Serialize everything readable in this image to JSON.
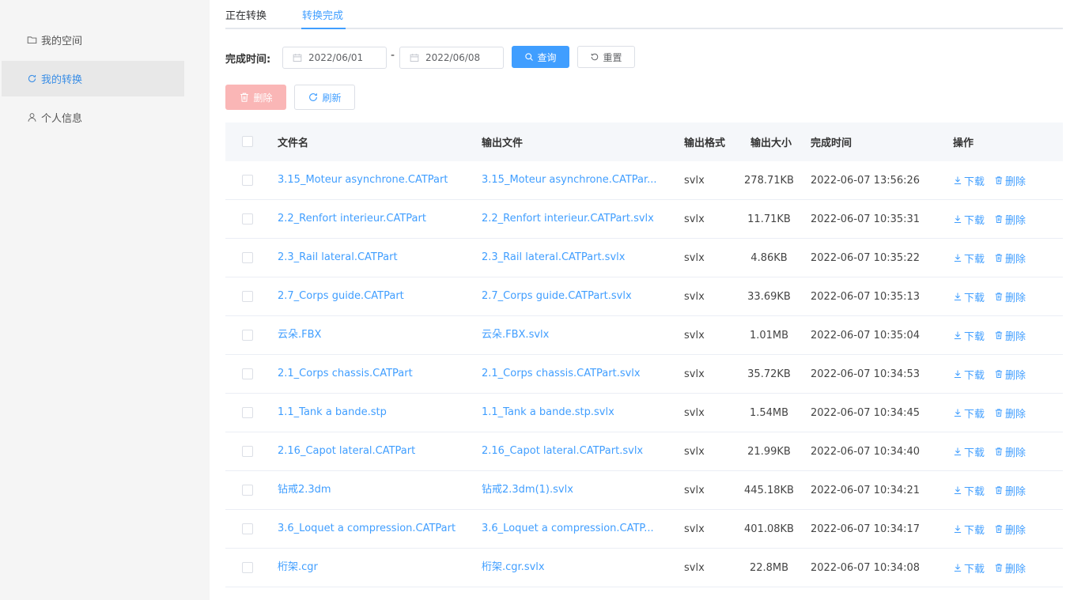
{
  "sidebar": {
    "items": [
      {
        "label": "我的空间",
        "icon": "folder-icon"
      },
      {
        "label": "我的转换",
        "icon": "refresh-icon"
      },
      {
        "label": "个人信息",
        "icon": "user-icon"
      }
    ]
  },
  "tabs": [
    {
      "label": "正在转换"
    },
    {
      "label": "转换完成"
    }
  ],
  "filter": {
    "label": "完成时间:",
    "start_date": "2022/06/01",
    "separator": "-",
    "end_date": "2022/06/08",
    "query_label": "查询",
    "reset_label": "重置"
  },
  "toolbar": {
    "delete_label": "删除",
    "refresh_label": "刷新"
  },
  "table": {
    "headers": {
      "filename": "文件名",
      "output": "输出文件",
      "format": "输出格式",
      "size": "输出大小",
      "time": "完成时间",
      "actions": "操作"
    },
    "download_label": "下载",
    "delete_label": "删除",
    "rows": [
      {
        "filename": "3.15_Moteur asynchrone.CATPart",
        "output": "3.15_Moteur asynchrone.CATPar...",
        "format": "svlx",
        "size": "278.71KB",
        "time": "2022-06-07 13:56:26"
      },
      {
        "filename": "2.2_Renfort interieur.CATPart",
        "output": "2.2_Renfort interieur.CATPart.svlx",
        "format": "svlx",
        "size": "11.71KB",
        "time": "2022-06-07 10:35:31"
      },
      {
        "filename": "2.3_Rail lateral.CATPart",
        "output": "2.3_Rail lateral.CATPart.svlx",
        "format": "svlx",
        "size": "4.86KB",
        "time": "2022-06-07 10:35:22"
      },
      {
        "filename": "2.7_Corps guide.CATPart",
        "output": "2.7_Corps guide.CATPart.svlx",
        "format": "svlx",
        "size": "33.69KB",
        "time": "2022-06-07 10:35:13"
      },
      {
        "filename": "云朵.FBX",
        "output": "云朵.FBX.svlx",
        "format": "svlx",
        "size": "1.01MB",
        "time": "2022-06-07 10:35:04"
      },
      {
        "filename": "2.1_Corps chassis.CATPart",
        "output": "2.1_Corps chassis.CATPart.svlx",
        "format": "svlx",
        "size": "35.72KB",
        "time": "2022-06-07 10:34:53"
      },
      {
        "filename": "1.1_Tank a bande.stp",
        "output": "1.1_Tank a bande.stp.svlx",
        "format": "svlx",
        "size": "1.54MB",
        "time": "2022-06-07 10:34:45"
      },
      {
        "filename": "2.16_Capot lateral.CATPart",
        "output": "2.16_Capot lateral.CATPart.svlx",
        "format": "svlx",
        "size": "21.99KB",
        "time": "2022-06-07 10:34:40"
      },
      {
        "filename": "钻戒2.3dm",
        "output": "钻戒2.3dm(1).svlx",
        "format": "svlx",
        "size": "445.18KB",
        "time": "2022-06-07 10:34:21"
      },
      {
        "filename": "3.6_Loquet a compression.CATPart",
        "output": "3.6_Loquet a compression.CATP...",
        "format": "svlx",
        "size": "401.08KB",
        "time": "2022-06-07 10:34:17"
      },
      {
        "filename": "桁架.cgr",
        "output": "桁架.cgr.svlx",
        "format": "svlx",
        "size": "22.8MB",
        "time": "2022-06-07 10:34:08"
      }
    ]
  },
  "colors": {
    "accent": "#409eff",
    "danger_disabled": "#fab6b6",
    "sidebar_bg": "#f5f5f5"
  }
}
